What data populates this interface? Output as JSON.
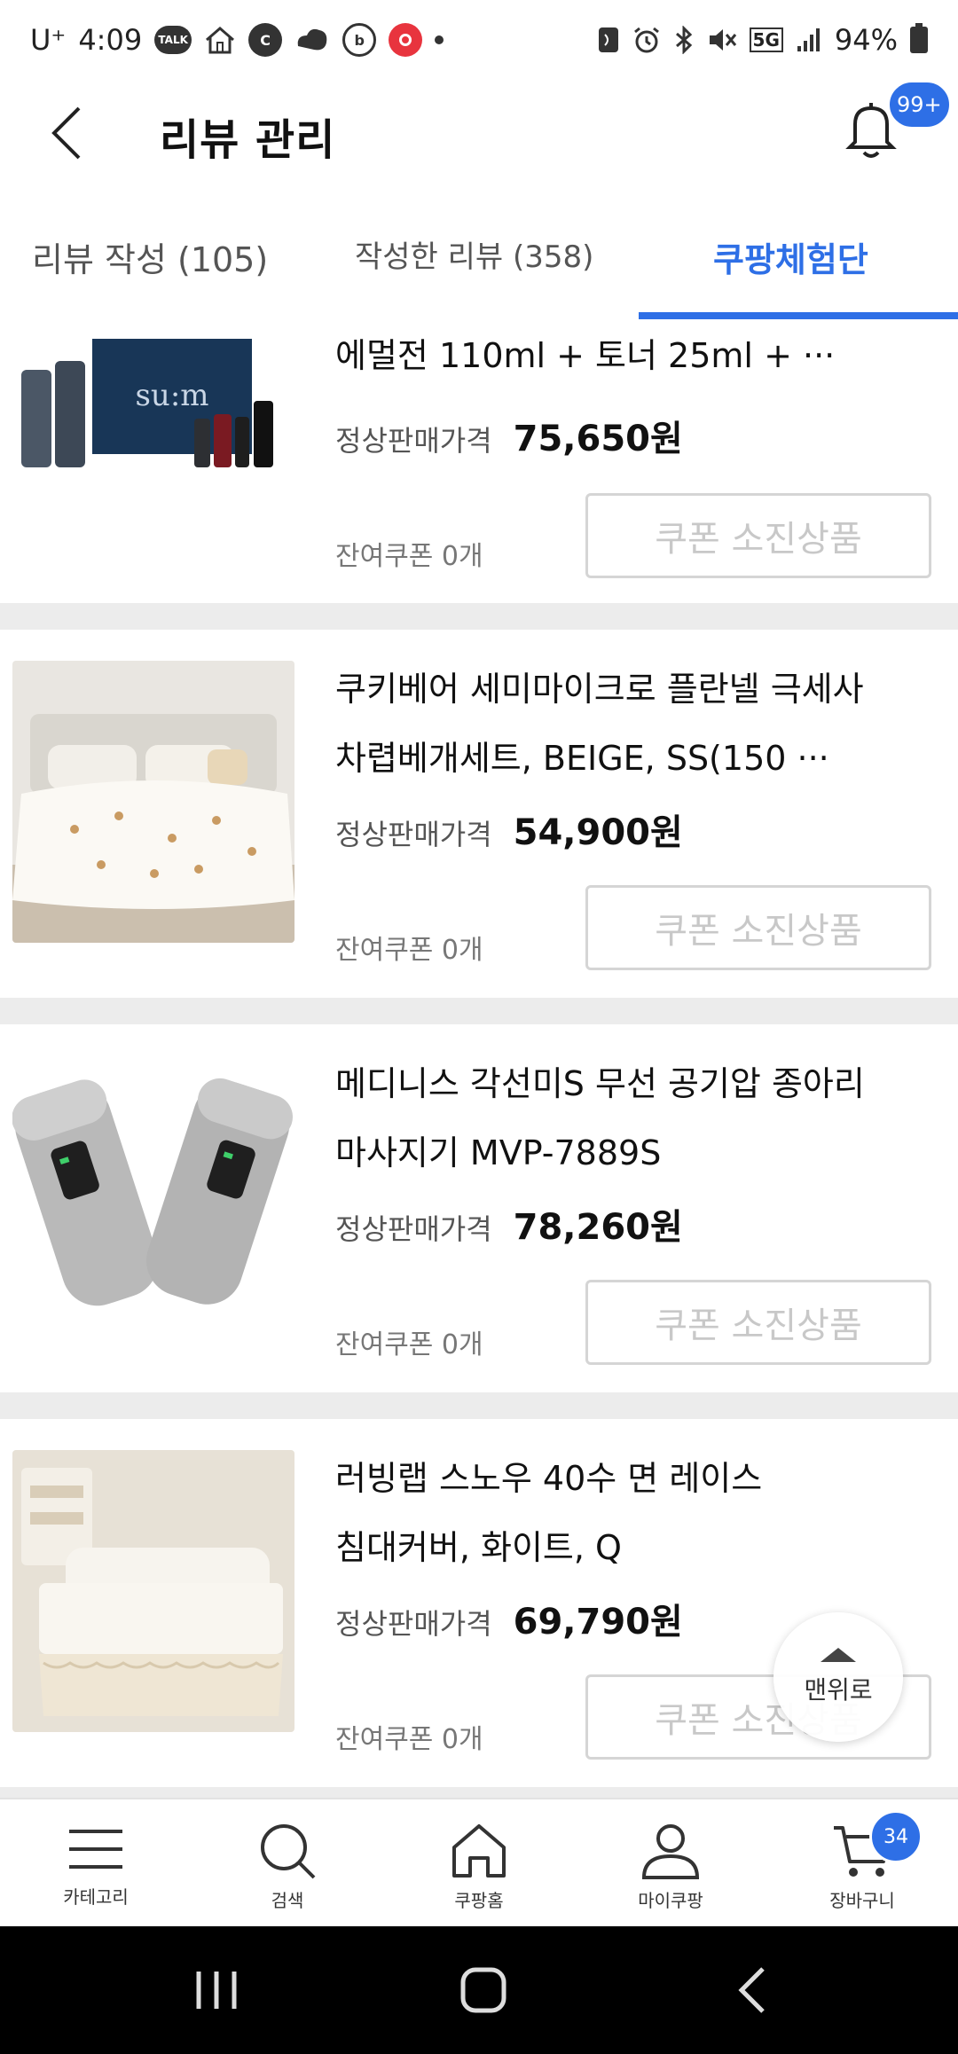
{
  "status_bar": {
    "carrier": "U⁺",
    "time": "4:09",
    "talk": "TALK",
    "c": "C",
    "b": "b",
    "network": "5G",
    "battery": "94%"
  },
  "header": {
    "title": "리뷰 관리",
    "notification_badge": "99+"
  },
  "tabs": [
    {
      "label": "리뷰 작성 (105)"
    },
    {
      "label": "작성한 리뷰 (358)"
    },
    {
      "label": "쿠팡체험단"
    }
  ],
  "products": [
    {
      "name_lines": [
        "에멀전 110ml + 토너 25ml + ···"
      ],
      "price_label": "정상판매가격",
      "price": "75,650원",
      "coupon_left": "잔여쿠폰 0개",
      "coupon_button": "쿠폰 소진상품"
    },
    {
      "name_lines": [
        "쿠키베어 세미마이크로 플란넬 극세사",
        "차렵베개세트, BEIGE, SS(150 ···"
      ],
      "price_label": "정상판매가격",
      "price": "54,900원",
      "coupon_left": "잔여쿠폰 0개",
      "coupon_button": "쿠폰 소진상품"
    },
    {
      "name_lines": [
        "메디니스 각선미S 무선 공기압 종아리",
        "마사지기 MVP-7889S"
      ],
      "price_label": "정상판매가격",
      "price": "78,260원",
      "coupon_left": "잔여쿠폰 0개",
      "coupon_button": "쿠폰 소진상품"
    },
    {
      "name_lines": [
        "러빙랩 스노우 40수 면 레이스",
        "침대커버, 화이트, Q"
      ],
      "price_label": "정상판매가격",
      "price": "69,790원",
      "coupon_left": "잔여쿠폰 0개",
      "coupon_button": "쿠폰 소진상품"
    }
  ],
  "scroll_top": {
    "label": "맨위로"
  },
  "bottom_nav": [
    {
      "label": "카테고리",
      "icon": "menu-icon"
    },
    {
      "label": "검색",
      "icon": "search-icon"
    },
    {
      "label": "쿠팡홈",
      "icon": "home-icon"
    },
    {
      "label": "마이쿠팡",
      "icon": "person-icon"
    },
    {
      "label": "장바구니",
      "icon": "cart-icon"
    }
  ],
  "cart_badge": "34",
  "colors": {
    "accent": "#2e6fe6",
    "separator": "#ececec",
    "disabled": "#c8c8c8"
  }
}
